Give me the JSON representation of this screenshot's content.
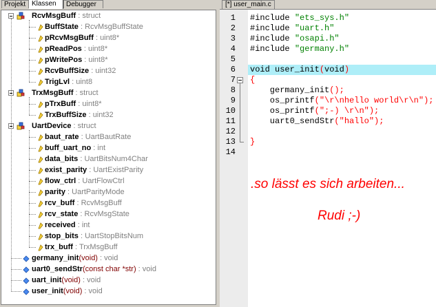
{
  "left_tabs": [
    "Projekt",
    "Klassen",
    "Debugger"
  ],
  "tree": [
    {
      "kind": "struct",
      "name": "RcvMsgBuff",
      "type": "struct"
    },
    {
      "kind": "member",
      "name": "BuffState",
      "type": "RcvMsgBuffState"
    },
    {
      "kind": "member",
      "name": "pRcvMsgBuff",
      "type": "uint8*"
    },
    {
      "kind": "member",
      "name": "pReadPos",
      "type": "uint8*"
    },
    {
      "kind": "member",
      "name": "pWritePos",
      "type": "uint8*"
    },
    {
      "kind": "member",
      "name": "RcvBuffSize",
      "type": "uint32"
    },
    {
      "kind": "member",
      "name": "TrigLvl",
      "type": "uint8"
    },
    {
      "kind": "struct",
      "name": "TrxMsgBuff",
      "type": "struct"
    },
    {
      "kind": "member",
      "name": "pTrxBuff",
      "type": "uint8*"
    },
    {
      "kind": "member",
      "name": "TrxBuffSize",
      "type": "uint32"
    },
    {
      "kind": "struct",
      "name": "UartDevice",
      "type": "struct"
    },
    {
      "kind": "member",
      "name": "baut_rate",
      "type": "UartBautRate"
    },
    {
      "kind": "member",
      "name": "buff_uart_no",
      "type": "int"
    },
    {
      "kind": "member",
      "name": "data_bits",
      "type": "UartBitsNum4Char"
    },
    {
      "kind": "member",
      "name": "exist_parity",
      "type": "UartExistParity"
    },
    {
      "kind": "member",
      "name": "flow_ctrl",
      "type": "UartFlowCtrl"
    },
    {
      "kind": "member",
      "name": "parity",
      "type": "UartParityMode"
    },
    {
      "kind": "member",
      "name": "rcv_buff",
      "type": "RcvMsgBuff"
    },
    {
      "kind": "member",
      "name": "rcv_state",
      "type": "RcvMsgState"
    },
    {
      "kind": "member",
      "name": "received",
      "type": "int"
    },
    {
      "kind": "member",
      "name": "stop_bits",
      "type": "UartStopBitsNum"
    },
    {
      "kind": "member",
      "name": "trx_buff",
      "type": "TrxMsgBuff"
    },
    {
      "kind": "function",
      "name": "germany_init",
      "args": "(void)",
      "type": "void"
    },
    {
      "kind": "function",
      "name": "uart0_sendStr",
      "args": "(const char *str)",
      "type": "void"
    },
    {
      "kind": "function",
      "name": "uart_init",
      "args": "(void)",
      "type": "void"
    },
    {
      "kind": "function",
      "name": "user_init",
      "args": "(void)",
      "type": "void"
    }
  ],
  "editor_tab": "[*] user_main.c",
  "code_lines": [
    {
      "n": "1",
      "segs": [
        [
          "kw",
          "#include "
        ],
        [
          "str",
          "\"ets_sys.h\""
        ]
      ]
    },
    {
      "n": "2",
      "segs": [
        [
          "kw",
          "#include "
        ],
        [
          "str",
          "\"uart.h\""
        ]
      ]
    },
    {
      "n": "3",
      "segs": [
        [
          "kw",
          "#include "
        ],
        [
          "str",
          "\"osapi.h\""
        ]
      ]
    },
    {
      "n": "4",
      "segs": [
        [
          "kw",
          "#include "
        ],
        [
          "str",
          "\"germany.h\""
        ]
      ]
    },
    {
      "n": "5",
      "segs": []
    },
    {
      "n": "6",
      "segs": [
        [
          "kw",
          "void user_init"
        ],
        [
          "punc",
          "("
        ],
        [
          "kw",
          "void"
        ],
        [
          "punc",
          ")"
        ]
      ]
    },
    {
      "n": "7",
      "segs": [
        [
          "punc",
          "{"
        ]
      ]
    },
    {
      "n": "8",
      "segs": [
        [
          "kw",
          "    germany_init"
        ],
        [
          "punc",
          "();"
        ]
      ]
    },
    {
      "n": "9",
      "segs": [
        [
          "kw",
          "    os_printf"
        ],
        [
          "punc",
          "("
        ],
        [
          "dq",
          "\"\\r\\nhello world\\r\\n\""
        ],
        [
          "punc",
          ");"
        ]
      ]
    },
    {
      "n": "10",
      "segs": [
        [
          "kw",
          "    os_printf"
        ],
        [
          "punc",
          "("
        ],
        [
          "dq",
          "\";-) \\r\\n\""
        ],
        [
          "punc",
          ");"
        ]
      ]
    },
    {
      "n": "11",
      "segs": [
        [
          "kw",
          "    uart0_sendStr"
        ],
        [
          "punc",
          "("
        ],
        [
          "dq",
          "\"hallo\""
        ],
        [
          "punc",
          ");"
        ]
      ]
    },
    {
      "n": "12",
      "segs": []
    },
    {
      "n": "13",
      "segs": [
        [
          "punc",
          "}"
        ]
      ]
    },
    {
      "n": "14",
      "segs": []
    }
  ],
  "overlay_text_1": ".so lässt es sich arbeiten...",
  "overlay_text_2": "Rudi ;-)",
  "colors": {
    "highlight": "#aeeef8",
    "string": "#008000",
    "red": "#ff0000"
  }
}
